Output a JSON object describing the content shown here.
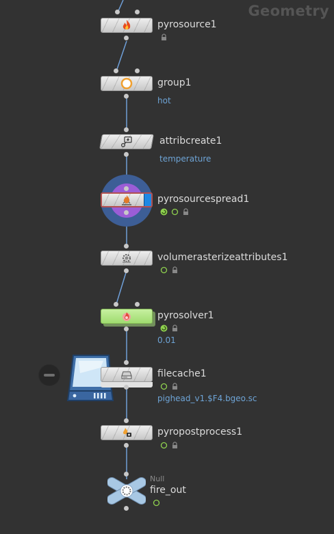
{
  "network": {
    "context_label": "Geometry"
  },
  "nodes": [
    {
      "id": "pyrosource1",
      "name": "pyrosource1",
      "param": "",
      "icon": "fire-icon",
      "flags": [
        "lock"
      ]
    },
    {
      "id": "group1",
      "name": "group1",
      "param": "hot",
      "icon": "circle-ring-icon",
      "flags": []
    },
    {
      "id": "attribcreate1",
      "name": "attribcreate1",
      "param": "temperature",
      "icon": "attribute-plus-icon",
      "flags": []
    },
    {
      "id": "pyrosourcespread1",
      "name": "pyrosourcespread1",
      "param": "",
      "icon": "flame-spread-icon",
      "flags": [
        "cook",
        "info",
        "lock"
      ],
      "display_flag_color": "#1e88e5"
    },
    {
      "id": "volumerasterizeattributes1",
      "name": "volumerasterizeattributes1",
      "param": "",
      "icon": "volume-gear-icon",
      "flags": [
        "info",
        "lock"
      ]
    },
    {
      "id": "pyrosolver1",
      "name": "pyrosolver1",
      "param": "0.01",
      "icon": "fireball-icon",
      "flags": [
        "cook",
        "lock"
      ],
      "node_color": "#a9e07a"
    },
    {
      "id": "filecache1",
      "name": "filecache1",
      "param": "pighead_v1.$F4.bgeo.sc",
      "icon": "disk-drive-icon",
      "flags": [
        "info",
        "lock"
      ]
    },
    {
      "id": "pyropostprocess1",
      "name": "pyropostprocess1",
      "param": "",
      "icon": "postprocess-icon",
      "flags": [
        "info",
        "lock"
      ]
    },
    {
      "id": "fire_out",
      "name": "fire_out",
      "type_label": "Null",
      "param": "",
      "icon": "null-gear-icon",
      "flags": [
        "info"
      ]
    }
  ],
  "colors": {
    "background": "#323232",
    "wire": "#6f9fd8",
    "param_text": "#6ea4d6",
    "flag_green": "#8fd14f",
    "selected_ring": "#3d5e96",
    "spread_halo": "#9b5dd6",
    "cache_blue": "#3f6fa8"
  }
}
